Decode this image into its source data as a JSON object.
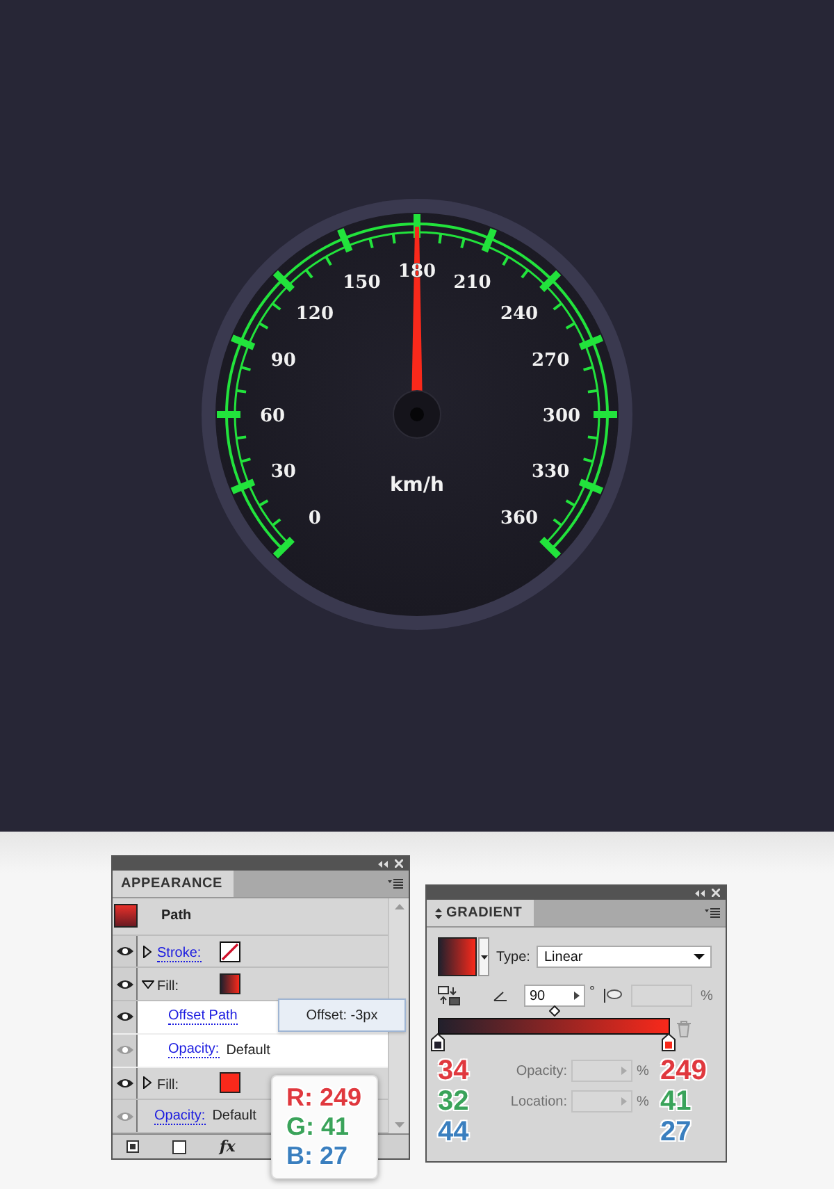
{
  "canvas": {
    "gauge": {
      "labels": [
        "0",
        "30",
        "60",
        "90",
        "120",
        "150",
        "180",
        "210",
        "240",
        "270",
        "300",
        "330",
        "360"
      ],
      "unit": "km/h",
      "level": 0.5
    }
  },
  "appearance_panel": {
    "title": "APPEARANCE",
    "object": "Path",
    "items": [
      {
        "kind": "stroke",
        "label": "Stroke:",
        "eye_active": true,
        "expanded": false,
        "swatch": {
          "kind": "none"
        }
      },
      {
        "kind": "fill",
        "label": "Fill:",
        "eye_active": true,
        "expanded": true,
        "swatch": {
          "kind": "gradient"
        },
        "children": [
          {
            "kind": "effect",
            "label": "Offset Path",
            "eye_active": true
          },
          {
            "kind": "opacity",
            "label": "Opacity:",
            "value": "Default",
            "eye_active": false
          }
        ]
      },
      {
        "kind": "fill",
        "label": "Fill:",
        "eye_active": true,
        "expanded": false,
        "swatch": {
          "kind": "solid"
        }
      },
      {
        "kind": "opacity",
        "label": "Opacity:",
        "value": "Default",
        "eye_active": false
      }
    ],
    "footer_fx": "fx"
  },
  "tooltip": "Offset: -3px",
  "rgb_callout": [
    {
      "text": "R: 249",
      "color": "#e0383e"
    },
    {
      "text": "G: 41",
      "color": "#3aa35a"
    },
    {
      "text": "B: 27",
      "color": "#3a7fbf"
    }
  ],
  "gradient_panel": {
    "title": "GRADIENT",
    "type_label": "Type:",
    "type_value": "Linear",
    "angle": "90",
    "degree": "°",
    "aspect_unit": "%",
    "midpoint": {
      "level": 0.5
    },
    "fields": [
      {
        "label": "Opacity:",
        "unit": "%",
        "disabled": true
      },
      {
        "label": "Location:",
        "unit": "%",
        "disabled": true
      }
    ],
    "stops": [
      {
        "color": "#22202c",
        "numbers": [
          {
            "text": "34",
            "color": "#e0383e"
          },
          {
            "text": "32",
            "color": "#3aa35a"
          },
          {
            "text": "44",
            "color": "#3a7fbf"
          }
        ]
      },
      {
        "color": "#f9291b",
        "numbers": [
          {
            "text": "249",
            "color": "#e0383e"
          },
          {
            "text": "41",
            "color": "#3aa35a"
          },
          {
            "text": "27",
            "color": "#3a7fbf"
          }
        ]
      }
    ]
  }
}
